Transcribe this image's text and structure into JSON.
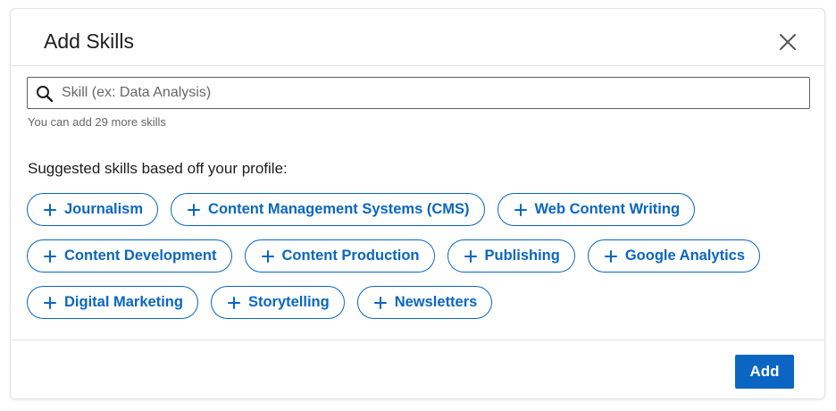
{
  "dialog": {
    "title": "Add Skills",
    "close_icon": "close-icon"
  },
  "search": {
    "icon": "search-icon",
    "value": "",
    "placeholder": "Skill (ex: Data Analysis)",
    "hint": "You can add 29 more skills"
  },
  "suggestions": {
    "heading": "Suggested skills based off your profile:",
    "chip_icon": "plus-icon",
    "chips": [
      "Journalism",
      "Content Management Systems (CMS)",
      "Web Content Writing",
      "Content Development",
      "Content Production",
      "Publishing",
      "Google Analytics",
      "Digital Marketing",
      "Storytelling",
      "Newsletters"
    ]
  },
  "footer": {
    "add_label": "Add"
  },
  "colors": {
    "accent": "#0a66c2",
    "text": "#1d1d1d",
    "muted": "#666666"
  }
}
